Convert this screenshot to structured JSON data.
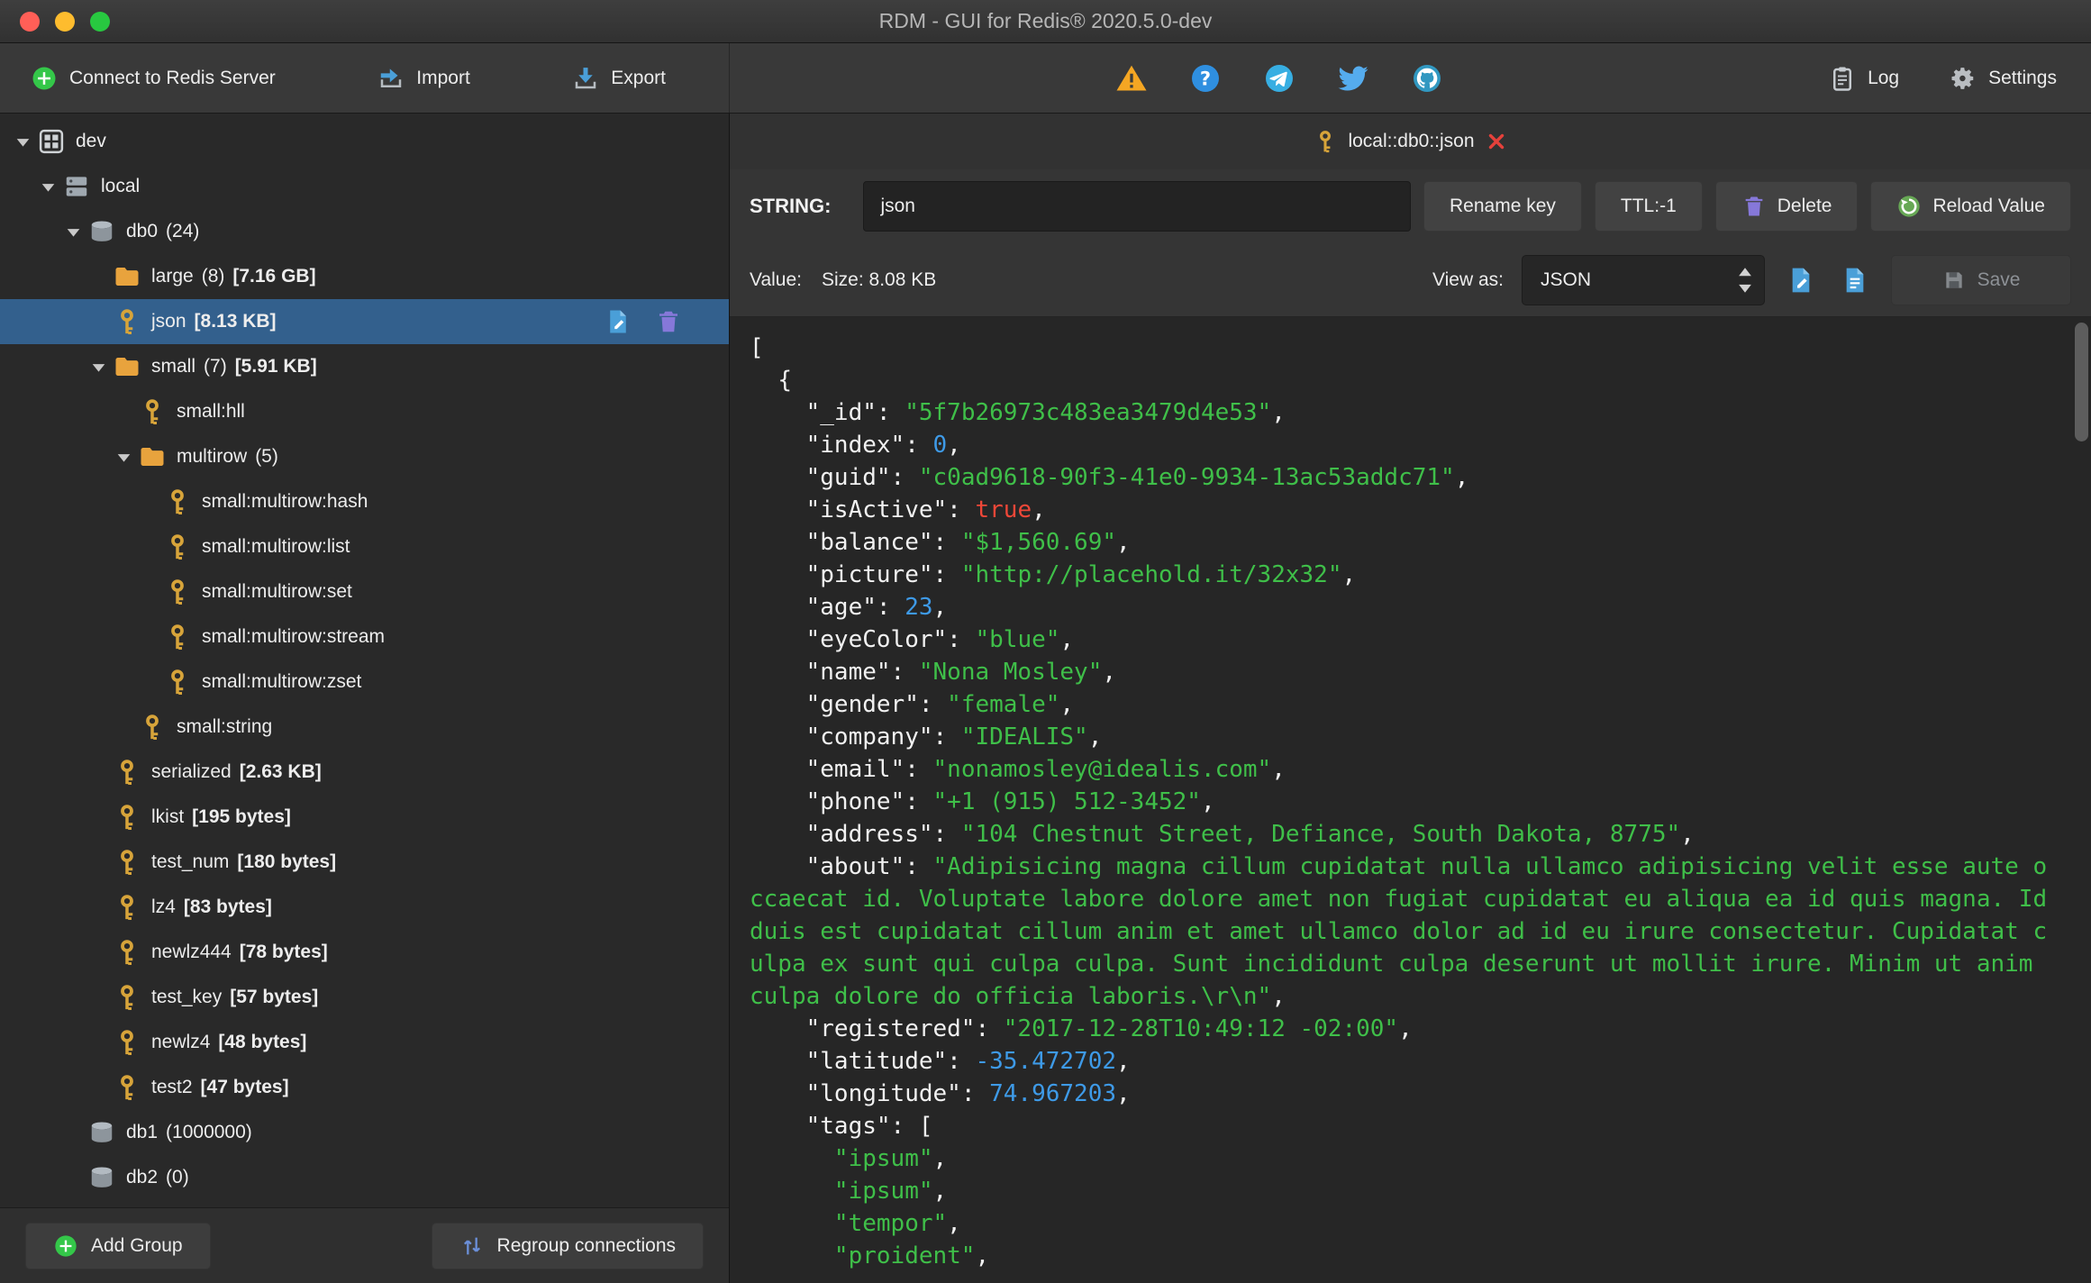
{
  "window": {
    "title": "RDM - GUI for Redis® 2020.5.0-dev"
  },
  "colors": {
    "selection": "#33608d",
    "accent_green": "#34c749",
    "key_gold": "#d7a43a",
    "folder_orange": "#e8a33d",
    "json_string": "#3fbf49",
    "json_number": "#3e9ae7",
    "json_bool": "#ef4738",
    "doc_blue": "#4a9fd8",
    "trash_purple": "#8678d9",
    "reload_green": "#67a855",
    "tab_close_red": "#e5413b"
  },
  "toolbar": {
    "connect_label": "Connect to Redis Server",
    "import_label": "Import",
    "export_label": "Export",
    "status_icons": [
      "warning-icon",
      "help-icon",
      "telegram-icon",
      "twitter-icon",
      "github-icon"
    ],
    "log_label": "Log",
    "settings_label": "Settings"
  },
  "sidebar": {
    "tree": [
      {
        "depth": 0,
        "arrow": true,
        "icon": "grid",
        "label": "dev"
      },
      {
        "depth": 1,
        "arrow": true,
        "icon": "server",
        "label": "local"
      },
      {
        "depth": 2,
        "arrow": true,
        "icon": "db",
        "label": "db0",
        "count": "(24)"
      },
      {
        "depth": 3,
        "arrow": false,
        "icon": "folder",
        "label": "large",
        "count": "(8)",
        "size": "[7.16 GB]"
      },
      {
        "depth": 3,
        "arrow": false,
        "icon": "key",
        "label": "json",
        "size": "[8.13 KB]",
        "selected": true,
        "actions": true
      },
      {
        "depth": 3,
        "arrow": true,
        "icon": "folder",
        "label": "small",
        "count": "(7)",
        "size": "[5.91 KB]"
      },
      {
        "depth": 4,
        "arrow": false,
        "icon": "key",
        "label": "small:hll"
      },
      {
        "depth": 4,
        "arrow": true,
        "icon": "folder",
        "label": "multirow",
        "count": "(5)"
      },
      {
        "depth": 5,
        "arrow": false,
        "icon": "key",
        "label": "small:multirow:hash"
      },
      {
        "depth": 5,
        "arrow": false,
        "icon": "key",
        "label": "small:multirow:list"
      },
      {
        "depth": 5,
        "arrow": false,
        "icon": "key",
        "label": "small:multirow:set"
      },
      {
        "depth": 5,
        "arrow": false,
        "icon": "key",
        "label": "small:multirow:stream"
      },
      {
        "depth": 5,
        "arrow": false,
        "icon": "key",
        "label": "small:multirow:zset"
      },
      {
        "depth": 4,
        "arrow": false,
        "icon": "key",
        "label": "small:string"
      },
      {
        "depth": 3,
        "arrow": false,
        "icon": "key",
        "label": "serialized",
        "size": "[2.63 KB]"
      },
      {
        "depth": 3,
        "arrow": false,
        "icon": "key",
        "label": "lkist",
        "size": "[195 bytes]"
      },
      {
        "depth": 3,
        "arrow": false,
        "icon": "key",
        "label": "test_num",
        "size": "[180 bytes]"
      },
      {
        "depth": 3,
        "arrow": false,
        "icon": "key",
        "label": "lz4",
        "size": "[83 bytes]"
      },
      {
        "depth": 3,
        "arrow": false,
        "icon": "key",
        "label": "newlz444",
        "size": "[78 bytes]"
      },
      {
        "depth": 3,
        "arrow": false,
        "icon": "key",
        "label": "test_key",
        "size": "[57 bytes]"
      },
      {
        "depth": 3,
        "arrow": false,
        "icon": "key",
        "label": "newlz4",
        "size": "[48 bytes]"
      },
      {
        "depth": 3,
        "arrow": false,
        "icon": "key",
        "label": "test2",
        "size": "[47 bytes]"
      },
      {
        "depth": 2,
        "arrow": false,
        "icon": "db",
        "label": "db1",
        "count": "(1000000)"
      },
      {
        "depth": 2,
        "arrow": false,
        "icon": "db",
        "label": "db2",
        "count": "(0)"
      }
    ],
    "add_group_label": "Add Group",
    "regroup_label": "Regroup connections"
  },
  "main": {
    "tab": {
      "label": "local::db0::json"
    },
    "key": {
      "type_label": "STRING:",
      "name_value": "json",
      "rename_label": "Rename key",
      "ttl_label": "TTL:-1",
      "delete_label": "Delete",
      "reload_label": "Reload Value"
    },
    "value_bar": {
      "value_label": "Value:",
      "size_label": "Size: 8.08 KB",
      "view_as_label": "View as:",
      "view_as_value": "JSON",
      "save_label": "Save"
    },
    "editor": {
      "lines": [
        [
          [
            "p",
            "["
          ]
        ],
        [
          [
            "p",
            "  {"
          ]
        ],
        [
          [
            "k",
            "    \"_id\""
          ],
          [
            "p",
            ": "
          ],
          [
            "s",
            "\"5f7b26973c483ea3479d4e53\""
          ],
          [
            "p",
            ","
          ]
        ],
        [
          [
            "k",
            "    \"index\""
          ],
          [
            "p",
            ": "
          ],
          [
            "n",
            "0"
          ],
          [
            "p",
            ","
          ]
        ],
        [
          [
            "k",
            "    \"guid\""
          ],
          [
            "p",
            ": "
          ],
          [
            "s",
            "\"c0ad9618-90f3-41e0-9934-13ac53addc71\""
          ],
          [
            "p",
            ","
          ]
        ],
        [
          [
            "k",
            "    \"isActive\""
          ],
          [
            "p",
            ": "
          ],
          [
            "b",
            "true"
          ],
          [
            "p",
            ","
          ]
        ],
        [
          [
            "k",
            "    \"balance\""
          ],
          [
            "p",
            ": "
          ],
          [
            "s",
            "\"$1,560.69\""
          ],
          [
            "p",
            ","
          ]
        ],
        [
          [
            "k",
            "    \"picture\""
          ],
          [
            "p",
            ": "
          ],
          [
            "s",
            "\"http://placehold.it/32x32\""
          ],
          [
            "p",
            ","
          ]
        ],
        [
          [
            "k",
            "    \"age\""
          ],
          [
            "p",
            ": "
          ],
          [
            "n",
            "23"
          ],
          [
            "p",
            ","
          ]
        ],
        [
          [
            "k",
            "    \"eyeColor\""
          ],
          [
            "p",
            ": "
          ],
          [
            "s",
            "\"blue\""
          ],
          [
            "p",
            ","
          ]
        ],
        [
          [
            "k",
            "    \"name\""
          ],
          [
            "p",
            ": "
          ],
          [
            "s",
            "\"Nona Mosley\""
          ],
          [
            "p",
            ","
          ]
        ],
        [
          [
            "k",
            "    \"gender\""
          ],
          [
            "p",
            ": "
          ],
          [
            "s",
            "\"female\""
          ],
          [
            "p",
            ","
          ]
        ],
        [
          [
            "k",
            "    \"company\""
          ],
          [
            "p",
            ": "
          ],
          [
            "s",
            "\"IDEALIS\""
          ],
          [
            "p",
            ","
          ]
        ],
        [
          [
            "k",
            "    \"email\""
          ],
          [
            "p",
            ": "
          ],
          [
            "s",
            "\"nonamosley@idealis.com\""
          ],
          [
            "p",
            ","
          ]
        ],
        [
          [
            "k",
            "    \"phone\""
          ],
          [
            "p",
            ": "
          ],
          [
            "s",
            "\"+1 (915) 512-3452\""
          ],
          [
            "p",
            ","
          ]
        ],
        [
          [
            "k",
            "    \"address\""
          ],
          [
            "p",
            ": "
          ],
          [
            "s",
            "\"104 Chestnut Street, Defiance, South Dakota, 8775\""
          ],
          [
            "p",
            ","
          ]
        ],
        [
          [
            "k",
            "    \"about\""
          ],
          [
            "p",
            ": "
          ],
          [
            "s",
            "\"Adipisicing magna cillum cupidatat nulla ullamco adipisicing velit esse aute occaecat id. Voluptate labore dolore amet non fugiat cupidatat eu aliqua ea id quis magna. Id duis est cupidatat cillum anim et amet ullamco dolor ad id eu irure consectetur. Cupidatat culpa ex sunt qui culpa culpa. Sunt incididunt culpa deserunt ut mollit irure. Minim ut anim culpa dolore do officia laboris.\\r\\n\""
          ],
          [
            "p",
            ","
          ]
        ],
        [
          [
            "k",
            "    \"registered\""
          ],
          [
            "p",
            ": "
          ],
          [
            "s",
            "\"2017-12-28T10:49:12 -02:00\""
          ],
          [
            "p",
            ","
          ]
        ],
        [
          [
            "k",
            "    \"latitude\""
          ],
          [
            "p",
            ": "
          ],
          [
            "n",
            "-35.472702"
          ],
          [
            "p",
            ","
          ]
        ],
        [
          [
            "k",
            "    \"longitude\""
          ],
          [
            "p",
            ": "
          ],
          [
            "n",
            "74.967203"
          ],
          [
            "p",
            ","
          ]
        ],
        [
          [
            "k",
            "    \"tags\""
          ],
          [
            "p",
            ": ["
          ]
        ],
        [
          [
            "p",
            "      "
          ],
          [
            "s",
            "\"ipsum\""
          ],
          [
            "p",
            ","
          ]
        ],
        [
          [
            "p",
            "      "
          ],
          [
            "s",
            "\"ipsum\""
          ],
          [
            "p",
            ","
          ]
        ],
        [
          [
            "p",
            "      "
          ],
          [
            "s",
            "\"tempor\""
          ],
          [
            "p",
            ","
          ]
        ],
        [
          [
            "p",
            "      "
          ],
          [
            "s",
            "\"proident\""
          ],
          [
            "p",
            ","
          ]
        ]
      ]
    }
  }
}
